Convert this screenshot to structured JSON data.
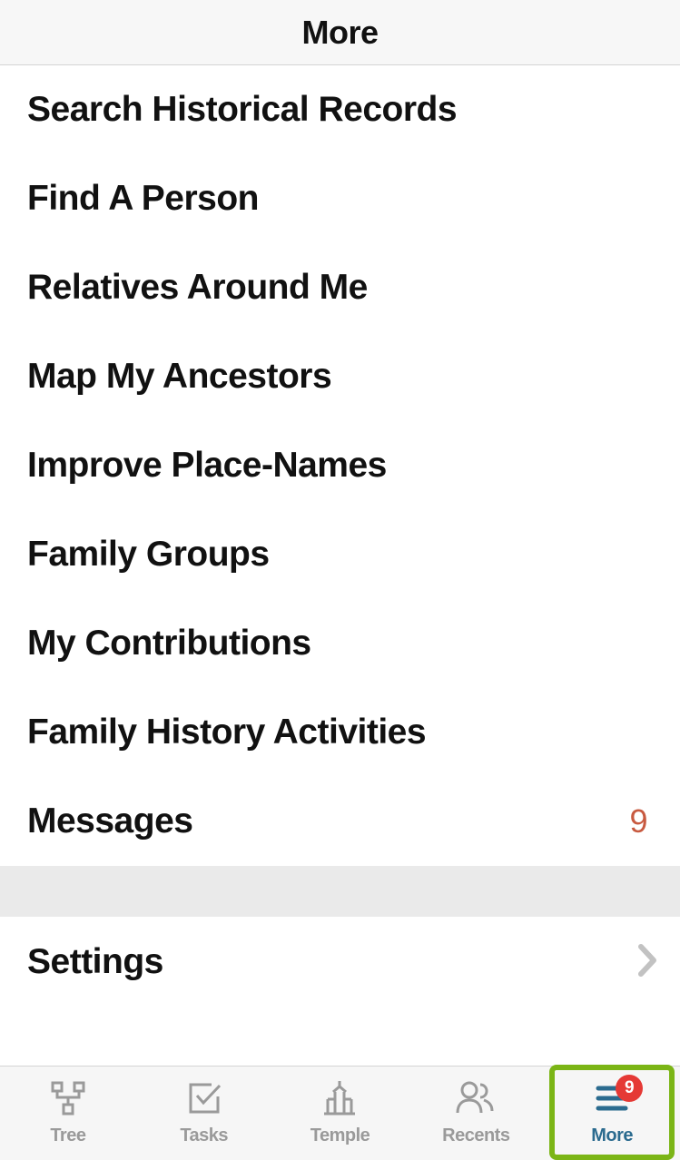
{
  "header": {
    "title": "More"
  },
  "menu": {
    "items": [
      {
        "label": "Search Historical Records"
      },
      {
        "label": "Find A Person"
      },
      {
        "label": "Relatives Around Me"
      },
      {
        "label": "Map My Ancestors"
      },
      {
        "label": "Improve Place-Names"
      },
      {
        "label": "Family Groups"
      },
      {
        "label": "My Contributions"
      },
      {
        "label": "Family History Activities"
      },
      {
        "label": "Messages",
        "badge": "9"
      }
    ],
    "settings": {
      "label": "Settings"
    }
  },
  "tabs": {
    "tree": {
      "label": "Tree"
    },
    "tasks": {
      "label": "Tasks"
    },
    "temple": {
      "label": "Temple"
    },
    "recents": {
      "label": "Recents"
    },
    "more": {
      "label": "More",
      "badge": "9"
    }
  }
}
